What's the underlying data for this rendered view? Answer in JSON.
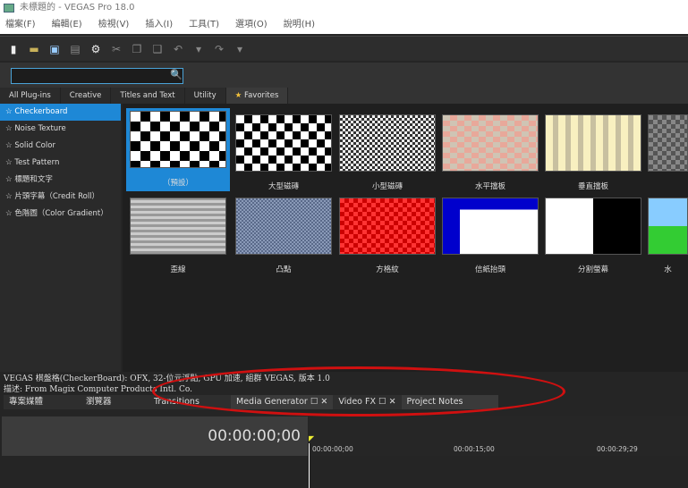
{
  "window": {
    "title": "未標題的 - VEGAS Pro 18.0"
  },
  "menu": [
    "檔案(F)",
    "編輯(E)",
    "檢視(V)",
    "插入(I)",
    "工具(T)",
    "選項(O)",
    "說明(H)"
  ],
  "toolbar": [
    "new-file-icon",
    "open-folder-icon",
    "save-icon",
    "render-icon",
    "gear-icon",
    "cut-icon",
    "copy-icon",
    "paste-icon",
    "undo-icon",
    "undo-dropdown-icon",
    "redo-icon",
    "redo-dropdown-icon"
  ],
  "search": {
    "value": "",
    "placeholder": ""
  },
  "tabs": [
    "All  Plug-ins",
    "Creative",
    "Titles  and  Text",
    "Utility",
    "Favorites"
  ],
  "plugins": [
    "Checkerboard",
    "Noise  Texture",
    "Solid  Color",
    "Test  Pattern",
    "標題和文字",
    "片頭字幕（Credit  Roll）",
    "色階圖（Color  Gradient）"
  ],
  "presets": [
    "（預設）",
    "大型磁磚",
    "小型磁磚",
    "水平擋板",
    "垂直擋板",
    "",
    "歪線",
    "凸點",
    "方格紋",
    "信紙抬頭",
    "分割螢幕",
    "水"
  ],
  "info": {
    "line1": "VEGAS 棋盤格(CheckerBoard): OFX, 32-位元浮點, GPU 加速, 組群 VEGAS, 版本 1.0",
    "line2": "描述: From Magix Computer Products Intl. Co."
  },
  "bottom_tabs": [
    "專案媒體",
    "瀏覽器",
    "Transitions",
    "Media Generator",
    "Video FX",
    "Project Notes"
  ],
  "timeline": {
    "timecode": "00:00:00;00",
    "ruler": [
      "00:00:00;00",
      "00:00:15;00",
      "00:00:29;29"
    ]
  },
  "colors": {
    "accent": "#1e88d6",
    "annotation": "#d01010"
  }
}
